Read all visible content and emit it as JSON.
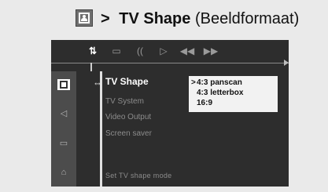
{
  "header": {
    "prefix": ">",
    "title": "TV Shape",
    "subtitle": "(Beeldformaat)",
    "icon": "tv-screen-icon"
  },
  "toolbar": {
    "items": [
      {
        "icon": "settings-icon",
        "glyph": "⇅",
        "active": true
      },
      {
        "icon": "subtitle-icon",
        "glyph": "▭",
        "active": false
      },
      {
        "icon": "angle-icon",
        "glyph": "((",
        "active": false
      },
      {
        "icon": "play-icon",
        "glyph": "▷",
        "active": false
      },
      {
        "icon": "rewind-icon",
        "glyph": "◀◀",
        "active": false
      },
      {
        "icon": "fast-forward-icon",
        "glyph": "▶▶",
        "active": false
      }
    ]
  },
  "sidebar": {
    "items": [
      {
        "icon": "tv-icon",
        "active": true
      },
      {
        "icon": "speaker-icon",
        "active": false
      },
      {
        "icon": "subtitle-menu-icon",
        "active": false
      },
      {
        "icon": "lock-icon",
        "active": false
      }
    ]
  },
  "menu": {
    "items": [
      {
        "label": "TV Shape",
        "selected": true
      },
      {
        "label": "TV System",
        "selected": false
      },
      {
        "label": "Video Output",
        "selected": false
      },
      {
        "label": "Screen saver",
        "selected": false
      }
    ],
    "options": [
      {
        "label": "4:3 panscan",
        "selected": true
      },
      {
        "label": "4:3 letterbox",
        "selected": false
      },
      {
        "label": "16:9",
        "selected": false
      }
    ],
    "status": "Set TV shape mode"
  },
  "colors": {
    "panel": "#2d2d2d",
    "sidebar": "#4c4c4c",
    "highlight": "#ffffff",
    "options_bg": "#f2f2f2"
  }
}
